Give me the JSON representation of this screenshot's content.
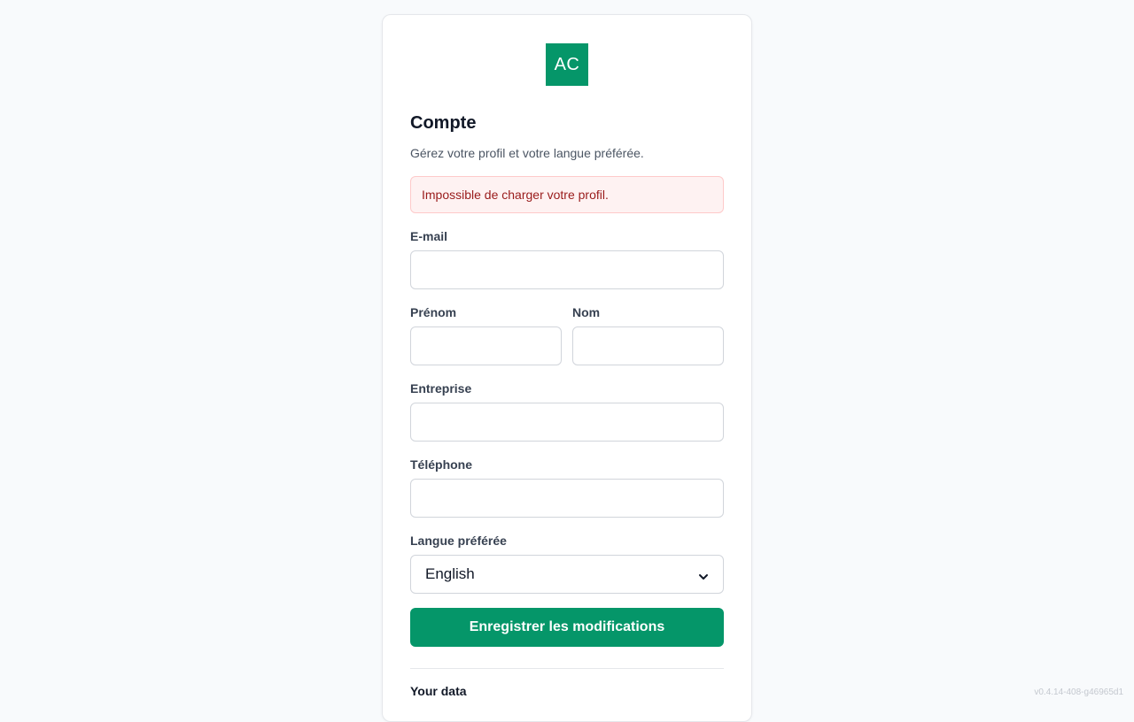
{
  "logo": {
    "text": "AC",
    "color": "#059669"
  },
  "header": {
    "title": "Compte",
    "subtitle": "Gérez votre profil et votre langue préférée."
  },
  "alert": {
    "message": "Impossible de charger votre profil.",
    "color": "#991b1b",
    "background": "#fef2f2"
  },
  "form": {
    "email": {
      "label": "E-mail",
      "value": "",
      "placeholder": ""
    },
    "first_name": {
      "label": "Prénom",
      "value": "",
      "placeholder": ""
    },
    "last_name": {
      "label": "Nom",
      "value": "",
      "placeholder": ""
    },
    "company": {
      "label": "Entreprise",
      "value": "",
      "placeholder": ""
    },
    "phone": {
      "label": "Téléphone",
      "value": "",
      "placeholder": ""
    },
    "language": {
      "label": "Langue préférée",
      "selected": "English"
    },
    "save_label": "Enregistrer les modifications"
  },
  "data_section": {
    "title": "Your data"
  },
  "footer": {
    "version": "v0.4.14-408-g46965d1"
  },
  "icons": {
    "select_arrow": "chevron-down-icon"
  },
  "colors": {
    "accent": "#059669",
    "background": "#f8fafc"
  }
}
